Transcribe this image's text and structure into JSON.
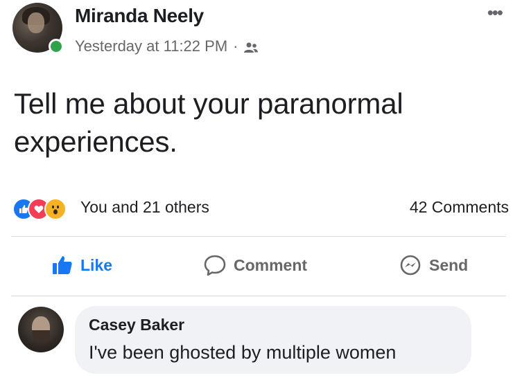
{
  "post": {
    "author": "Miranda Neely",
    "timestamp": "Yesterday at 11:22 PM",
    "separator": "·",
    "audience_icon": "friends-icon",
    "more_icon": "•••",
    "text": "Tell me about your paranormal experiences.",
    "online": true
  },
  "reactions": {
    "icons": [
      "like-reaction-icon",
      "love-reaction-icon",
      "wow-reaction-icon"
    ],
    "summary": "You and 21 others",
    "comments": "42 Comments"
  },
  "actions": {
    "like": "Like",
    "comment": "Comment",
    "send": "Send"
  },
  "comment": {
    "author": "Casey Baker",
    "text": "I've been ghosted by multiple women"
  },
  "colors": {
    "accent": "#1877f2",
    "love": "#f33e58",
    "wow": "#f7b125",
    "online": "#31a24c",
    "secondary_text": "#65676b",
    "bubble": "#f0f2f5"
  }
}
